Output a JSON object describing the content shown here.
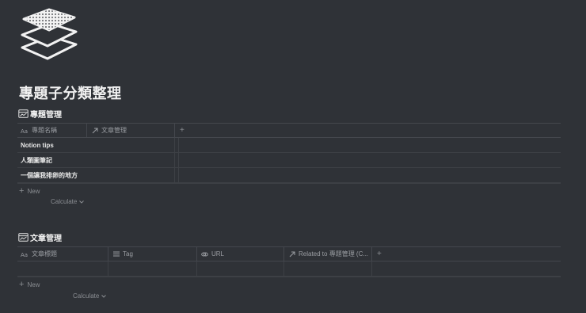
{
  "page": {
    "icon": "layers-icon",
    "title": "專題子分類整理"
  },
  "databases": [
    {
      "title": "專題管理",
      "icon": "table-icon",
      "columns": [
        {
          "icon": "text-aa-icon",
          "label": "專題名稱"
        },
        {
          "icon": "relation-arrow-icon",
          "label": "文章管理"
        }
      ],
      "add_column": "+",
      "rows": [
        [
          "Notion tips",
          ""
        ],
        [
          "人類圖筆記",
          ""
        ],
        [
          "一個讓我排卵的地方",
          ""
        ]
      ],
      "new_label": "New",
      "calculate_label": "Calculate"
    },
    {
      "title": "文章管理",
      "icon": "table-icon",
      "columns": [
        {
          "icon": "text-aa-icon",
          "label": "文章標題"
        },
        {
          "icon": "list-icon",
          "label": "Tag"
        },
        {
          "icon": "link-icon",
          "label": "URL"
        },
        {
          "icon": "relation-arrow-icon",
          "label": "Related to 專題管理 (C..."
        }
      ],
      "add_column": "+",
      "rows": [
        [
          "",
          "",
          "",
          ""
        ]
      ],
      "new_label": "New",
      "calculate_label": "Calculate"
    }
  ]
}
